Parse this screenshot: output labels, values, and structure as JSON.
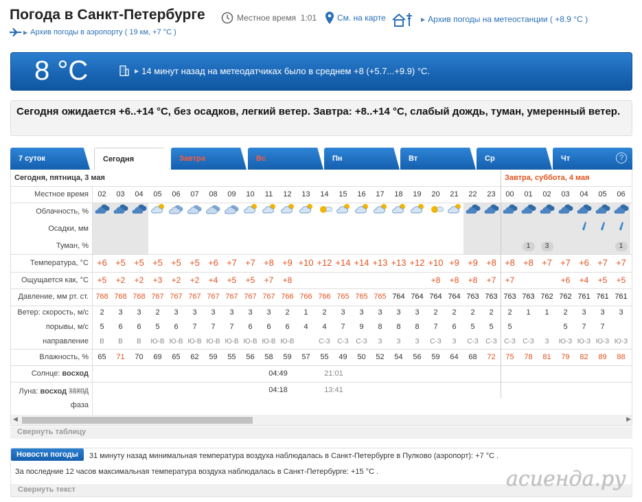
{
  "header": {
    "title": "Погода в Санкт-Петербурге",
    "local_time_label": "Местное время",
    "local_time": "1:01",
    "map_link": "См. на карте",
    "archive_stations_link": "Архив погоды на метеостанции ( +8.9 °C )",
    "archive_airport_link": "Архив погоды в аэропорту ( 19 км, +7 °C )"
  },
  "banner": {
    "temperature": "8 °C",
    "text": "14 минут назад на метеодатчиках было в среднем +8 (+5.7...+9.9) °C."
  },
  "forecast_text": "Сегодня ожидается +6..+14 °C, без осадков, легкий ветер. Завтра: +8..+14 °C, слабый дождь, туман, умеренный ветер.",
  "tabs": [
    "7 суток",
    "Сегодня",
    "Завтра",
    "Вс",
    "Пн",
    "Вт",
    "Ср",
    "Чт"
  ],
  "help_label": "?",
  "table": {
    "today_header": "Сегодня, пятница, 3 мая",
    "tomorrow_header": "Завтра, суббота, 4 мая",
    "labels": {
      "time": "Местное время",
      "clouds": "Облачность, %",
      "precip": "Осадки, мм",
      "fog": "Туман, %",
      "temp": "Температура, °C",
      "feels": "Ощущается как, °C",
      "pressure": "Давление, мм рт. ст.",
      "wind_speed": "Ветер: скорость, м/с",
      "gusts": "порывы, м/с",
      "direction": "направление",
      "humidity": "Влажность, %",
      "sun_prefix": "Солнце:",
      "sun_rise": "восход",
      "sun_set": "заход",
      "moon_prefix": "Луна:",
      "moon_rise": "восход",
      "moon_set": "заход",
      "phase": "фаза"
    },
    "hours": [
      "02",
      "03",
      "04",
      "05",
      "06",
      "07",
      "08",
      "09",
      "10",
      "11",
      "12",
      "13",
      "14",
      "15",
      "16",
      "17",
      "18",
      "19",
      "20",
      "21",
      "22",
      "23",
      "00",
      "01",
      "02",
      "03",
      "04",
      "05",
      "06"
    ],
    "cloud_icons": [
      "overcast-icon",
      "overcast-icon",
      "overcast-icon",
      "partly-cloudy-icon",
      "cloudy-icon",
      "cloudy-icon",
      "cloudy-icon",
      "cloudy-icon",
      "partly-cloudy-icon",
      "partly-cloudy-icon",
      "partly-cloudy-icon",
      "partly-cloudy-icon",
      "sun-icon",
      "partly-cloudy-icon",
      "partly-cloudy-icon",
      "partly-cloudy-icon",
      "partly-cloudy-icon",
      "partly-cloudy-icon",
      "sun-icon",
      "partly-cloudy-icon",
      "overcast-icon",
      "overcast-icon",
      "overcast-icon",
      "overcast-icon",
      "overcast-icon",
      "overcast-icon",
      "overcast-icon",
      "overcast-icon",
      "overcast-icon"
    ],
    "precip_drops_at": [
      26,
      27,
      28
    ],
    "fog": {
      "23": "1",
      "24": "3",
      "28": "1"
    },
    "temps": [
      "+6",
      "+5",
      "+5",
      "+5",
      "+5",
      "+5",
      "+6",
      "+7",
      "+7",
      "+8",
      "+9",
      "+10",
      "+12",
      "+14",
      "+14",
      "+13",
      "+13",
      "+12",
      "+10",
      "+9",
      "+9",
      "+8",
      "+8",
      "+8",
      "+7",
      "+7",
      "+6",
      "+7",
      "+7"
    ],
    "feels": [
      "+5",
      "+2",
      "+2",
      "+3",
      "+2",
      "+2",
      "+4",
      "+5",
      "+5",
      "+7",
      "+8",
      "",
      "",
      "",
      "",
      "",
      "",
      "",
      "+8",
      "+8",
      "+8",
      "+7",
      "+7",
      "",
      "",
      "+6",
      "+4",
      "+5",
      "+5"
    ],
    "pressure": [
      "768",
      "768",
      "768",
      "767",
      "767",
      "767",
      "767",
      "767",
      "767",
      "767",
      "766",
      "766",
      "766",
      "765",
      "765",
      "765",
      "764",
      "764",
      "764",
      "764",
      "763",
      "763",
      "763",
      "763",
      "762",
      "762",
      "761",
      "761",
      "761"
    ],
    "pressure_dark_from": 16,
    "wind_speed": [
      "2",
      "3",
      "3",
      "2",
      "3",
      "3",
      "3",
      "3",
      "3",
      "3",
      "2",
      "1",
      "2",
      "3",
      "3",
      "3",
      "3",
      "3",
      "2",
      "2",
      "2",
      "2",
      "2",
      "1",
      "1",
      "2",
      "3",
      "3",
      "3"
    ],
    "gusts": [
      "5",
      "6",
      "6",
      "5",
      "6",
      "7",
      "7",
      "7",
      "6",
      "6",
      "6",
      "4",
      "4",
      "7",
      "9",
      "8",
      "8",
      "8",
      "7",
      "6",
      "5",
      "5",
      "5",
      "",
      "",
      "5",
      "7",
      "7",
      ""
    ],
    "directions": [
      "В",
      "В",
      "В",
      "Ю-В",
      "Ю-В",
      "Ю-В",
      "Ю-В",
      "Ю-В",
      "Ю-В",
      "Ю-В",
      "Ю-В",
      "",
      "С-З",
      "С-З",
      "С-З",
      "З",
      "З",
      "З",
      "С-З",
      "З",
      "С-З",
      "С-З",
      "С-З",
      "С-З",
      "З",
      "Ю-З",
      "Ю-З",
      "Ю-З",
      "Ю-З"
    ],
    "humidity": [
      "65",
      "71",
      "70",
      "69",
      "65",
      "62",
      "59",
      "55",
      "56",
      "58",
      "59",
      "57",
      "55",
      "49",
      "50",
      "52",
      "54",
      "56",
      "59",
      "64",
      "68",
      "72",
      "75",
      "78",
      "81",
      "79",
      "82",
      "89",
      "88"
    ],
    "humidity_red": [
      1,
      21,
      22,
      23,
      24,
      25,
      26,
      27,
      28
    ],
    "sun_rise_time": "04:49",
    "sun_set_time": "21:01",
    "moon_rise_time": "04:18",
    "moon_set_time": "13:41",
    "collapse_label": "Свернуть таблицу"
  },
  "news": {
    "tag": "Новости погоды",
    "line1": "31 минуту назад минимальная температура воздуха наблюдалась в Санкт-Петербурге в Пулково (аэропорт): +7 °C .",
    "line2": "За последние 12 часов максимальная температура воздуха наблюдалась в Санкт-Петербурге: +15 °C .",
    "collapse_label": "Свернуть текст"
  },
  "watermark": "асиенда.ру"
}
